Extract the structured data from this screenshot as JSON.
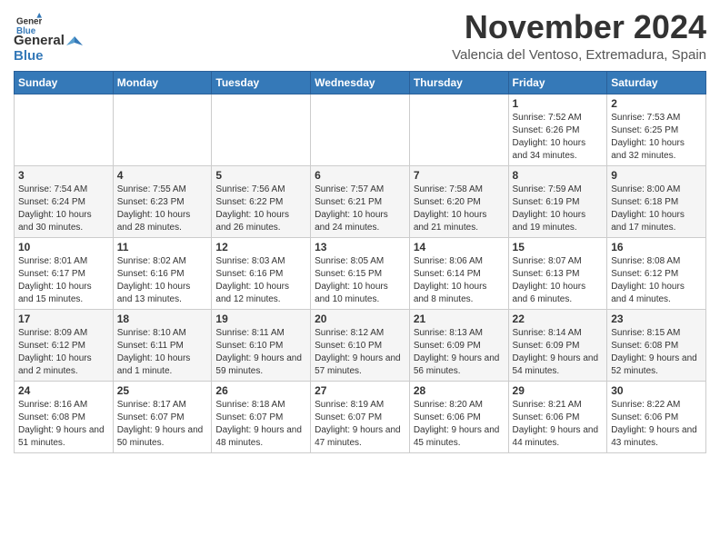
{
  "header": {
    "logo_line1": "General",
    "logo_line2": "Blue",
    "month": "November 2024",
    "location": "Valencia del Ventoso, Extremadura, Spain"
  },
  "weekdays": [
    "Sunday",
    "Monday",
    "Tuesday",
    "Wednesday",
    "Thursday",
    "Friday",
    "Saturday"
  ],
  "weeks": [
    [
      {
        "day": "",
        "info": ""
      },
      {
        "day": "",
        "info": ""
      },
      {
        "day": "",
        "info": ""
      },
      {
        "day": "",
        "info": ""
      },
      {
        "day": "",
        "info": ""
      },
      {
        "day": "1",
        "info": "Sunrise: 7:52 AM\nSunset: 6:26 PM\nDaylight: 10 hours and 34 minutes."
      },
      {
        "day": "2",
        "info": "Sunrise: 7:53 AM\nSunset: 6:25 PM\nDaylight: 10 hours and 32 minutes."
      }
    ],
    [
      {
        "day": "3",
        "info": "Sunrise: 7:54 AM\nSunset: 6:24 PM\nDaylight: 10 hours and 30 minutes."
      },
      {
        "day": "4",
        "info": "Sunrise: 7:55 AM\nSunset: 6:23 PM\nDaylight: 10 hours and 28 minutes."
      },
      {
        "day": "5",
        "info": "Sunrise: 7:56 AM\nSunset: 6:22 PM\nDaylight: 10 hours and 26 minutes."
      },
      {
        "day": "6",
        "info": "Sunrise: 7:57 AM\nSunset: 6:21 PM\nDaylight: 10 hours and 24 minutes."
      },
      {
        "day": "7",
        "info": "Sunrise: 7:58 AM\nSunset: 6:20 PM\nDaylight: 10 hours and 21 minutes."
      },
      {
        "day": "8",
        "info": "Sunrise: 7:59 AM\nSunset: 6:19 PM\nDaylight: 10 hours and 19 minutes."
      },
      {
        "day": "9",
        "info": "Sunrise: 8:00 AM\nSunset: 6:18 PM\nDaylight: 10 hours and 17 minutes."
      }
    ],
    [
      {
        "day": "10",
        "info": "Sunrise: 8:01 AM\nSunset: 6:17 PM\nDaylight: 10 hours and 15 minutes."
      },
      {
        "day": "11",
        "info": "Sunrise: 8:02 AM\nSunset: 6:16 PM\nDaylight: 10 hours and 13 minutes."
      },
      {
        "day": "12",
        "info": "Sunrise: 8:03 AM\nSunset: 6:16 PM\nDaylight: 10 hours and 12 minutes."
      },
      {
        "day": "13",
        "info": "Sunrise: 8:05 AM\nSunset: 6:15 PM\nDaylight: 10 hours and 10 minutes."
      },
      {
        "day": "14",
        "info": "Sunrise: 8:06 AM\nSunset: 6:14 PM\nDaylight: 10 hours and 8 minutes."
      },
      {
        "day": "15",
        "info": "Sunrise: 8:07 AM\nSunset: 6:13 PM\nDaylight: 10 hours and 6 minutes."
      },
      {
        "day": "16",
        "info": "Sunrise: 8:08 AM\nSunset: 6:12 PM\nDaylight: 10 hours and 4 minutes."
      }
    ],
    [
      {
        "day": "17",
        "info": "Sunrise: 8:09 AM\nSunset: 6:12 PM\nDaylight: 10 hours and 2 minutes."
      },
      {
        "day": "18",
        "info": "Sunrise: 8:10 AM\nSunset: 6:11 PM\nDaylight: 10 hours and 1 minute."
      },
      {
        "day": "19",
        "info": "Sunrise: 8:11 AM\nSunset: 6:10 PM\nDaylight: 9 hours and 59 minutes."
      },
      {
        "day": "20",
        "info": "Sunrise: 8:12 AM\nSunset: 6:10 PM\nDaylight: 9 hours and 57 minutes."
      },
      {
        "day": "21",
        "info": "Sunrise: 8:13 AM\nSunset: 6:09 PM\nDaylight: 9 hours and 56 minutes."
      },
      {
        "day": "22",
        "info": "Sunrise: 8:14 AM\nSunset: 6:09 PM\nDaylight: 9 hours and 54 minutes."
      },
      {
        "day": "23",
        "info": "Sunrise: 8:15 AM\nSunset: 6:08 PM\nDaylight: 9 hours and 52 minutes."
      }
    ],
    [
      {
        "day": "24",
        "info": "Sunrise: 8:16 AM\nSunset: 6:08 PM\nDaylight: 9 hours and 51 minutes."
      },
      {
        "day": "25",
        "info": "Sunrise: 8:17 AM\nSunset: 6:07 PM\nDaylight: 9 hours and 50 minutes."
      },
      {
        "day": "26",
        "info": "Sunrise: 8:18 AM\nSunset: 6:07 PM\nDaylight: 9 hours and 48 minutes."
      },
      {
        "day": "27",
        "info": "Sunrise: 8:19 AM\nSunset: 6:07 PM\nDaylight: 9 hours and 47 minutes."
      },
      {
        "day": "28",
        "info": "Sunrise: 8:20 AM\nSunset: 6:06 PM\nDaylight: 9 hours and 45 minutes."
      },
      {
        "day": "29",
        "info": "Sunrise: 8:21 AM\nSunset: 6:06 PM\nDaylight: 9 hours and 44 minutes."
      },
      {
        "day": "30",
        "info": "Sunrise: 8:22 AM\nSunset: 6:06 PM\nDaylight: 9 hours and 43 minutes."
      }
    ]
  ]
}
